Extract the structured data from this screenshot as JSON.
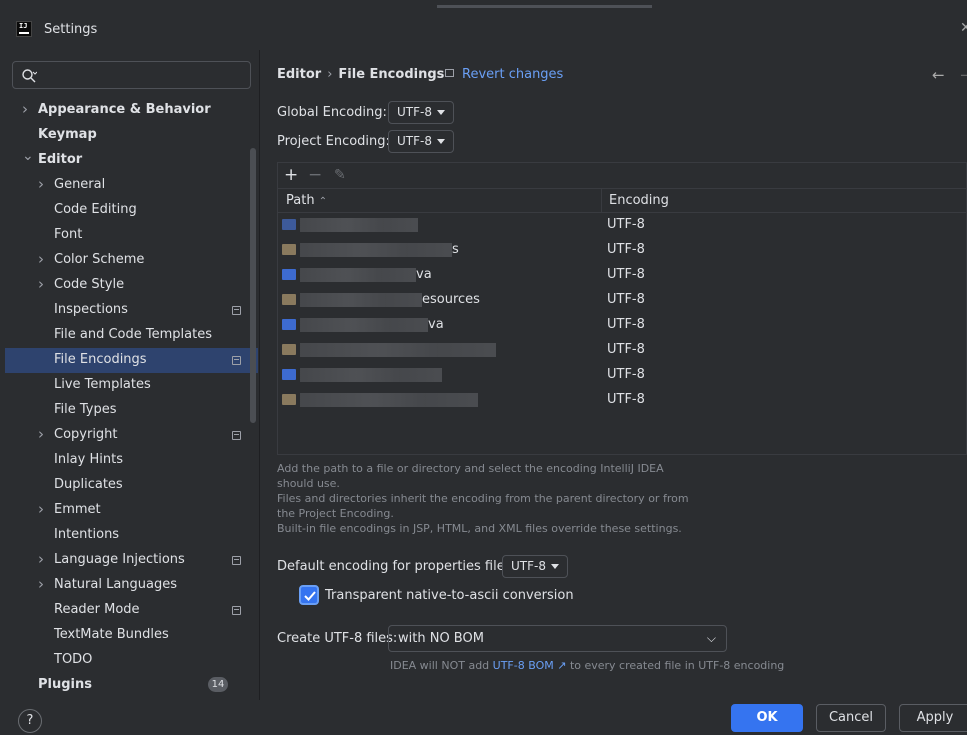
{
  "window": {
    "title": "Settings",
    "logo_text": "IJ"
  },
  "search": {
    "placeholder": "",
    "value": ""
  },
  "sidebar": {
    "items": [
      {
        "label": "Appearance & Behavior",
        "level": 0,
        "bold": true,
        "chevron": "right"
      },
      {
        "label": "Keymap",
        "level": 0,
        "bold": true,
        "chevron": ""
      },
      {
        "label": "Editor",
        "level": 0,
        "bold": true,
        "chevron": "down"
      },
      {
        "label": "General",
        "level": 1,
        "chevron": "right"
      },
      {
        "label": "Code Editing",
        "level": 1,
        "chevron": ""
      },
      {
        "label": "Font",
        "level": 1,
        "chevron": ""
      },
      {
        "label": "Color Scheme",
        "level": 1,
        "chevron": "right"
      },
      {
        "label": "Code Style",
        "level": 1,
        "chevron": "right"
      },
      {
        "label": "Inspections",
        "level": 1,
        "chevron": "",
        "project_icon": true
      },
      {
        "label": "File and Code Templates",
        "level": 1,
        "chevron": ""
      },
      {
        "label": "File Encodings",
        "level": 1,
        "chevron": "",
        "project_icon": true,
        "selected": true
      },
      {
        "label": "Live Templates",
        "level": 1,
        "chevron": ""
      },
      {
        "label": "File Types",
        "level": 1,
        "chevron": ""
      },
      {
        "label": "Copyright",
        "level": 1,
        "chevron": "right",
        "project_icon": true
      },
      {
        "label": "Inlay Hints",
        "level": 1,
        "chevron": ""
      },
      {
        "label": "Duplicates",
        "level": 1,
        "chevron": ""
      },
      {
        "label": "Emmet",
        "level": 1,
        "chevron": "right"
      },
      {
        "label": "Intentions",
        "level": 1,
        "chevron": ""
      },
      {
        "label": "Language Injections",
        "level": 1,
        "chevron": "right",
        "project_icon": true
      },
      {
        "label": "Natural Languages",
        "level": 1,
        "chevron": "right"
      },
      {
        "label": "Reader Mode",
        "level": 1,
        "chevron": "",
        "project_icon": true
      },
      {
        "label": "TextMate Bundles",
        "level": 1,
        "chevron": ""
      },
      {
        "label": "TODO",
        "level": 1,
        "chevron": ""
      },
      {
        "label": "Plugins",
        "level": 0,
        "bold": true,
        "chevron": "",
        "badge": "14"
      }
    ]
  },
  "header": {
    "crumb_parent": "Editor",
    "crumb_current": "File Encodings",
    "revert_label": "Revert changes"
  },
  "encodings": {
    "global_label": "Global Encoding:",
    "global_value": "UTF-8",
    "project_label": "Project Encoding:",
    "project_value": "UTF-8"
  },
  "table": {
    "col_path": "Path",
    "col_encoding": "Encoding",
    "rows": [
      {
        "path_suffix": "",
        "encoding": "UTF-8",
        "icon_color": "#3d5a9a",
        "blur_w": 118
      },
      {
        "path_suffix": "s",
        "encoding": "UTF-8",
        "icon_color": "#8a7a5e",
        "blur_w": 152
      },
      {
        "path_suffix": "va",
        "encoding": "UTF-8",
        "icon_color": "#3d6bd1",
        "blur_w": 116
      },
      {
        "path_suffix": "esources",
        "encoding": "UTF-8",
        "icon_color": "#8a7a5e",
        "blur_w": 122
      },
      {
        "path_suffix": "va",
        "encoding": "UTF-8",
        "icon_color": "#3d6bd1",
        "blur_w": 128
      },
      {
        "path_suffix": "",
        "encoding": "UTF-8",
        "icon_color": "#8a7a5e",
        "blur_w": 196
      },
      {
        "path_suffix": "",
        "encoding": "UTF-8",
        "icon_color": "#3d6bd1",
        "blur_w": 142
      },
      {
        "path_suffix": "",
        "encoding": "UTF-8",
        "icon_color": "#8a7a5e",
        "blur_w": 178
      }
    ]
  },
  "help": {
    "line1": "Add the path to a file or directory and select the encoding IntelliJ IDEA should use.",
    "line2": "Files and directories inherit the encoding from the parent directory or from the Project Encoding.",
    "line3": "Built-in file encodings in JSP, HTML, and XML files override these settings."
  },
  "properties": {
    "label": "Default encoding for properties files:",
    "value": "UTF-8",
    "native_label": "Transparent native-to-ascii conversion",
    "native_checked": true
  },
  "bom": {
    "label": "Create UTF-8 files:",
    "value": "with NO BOM",
    "hint_pre": "IDEA will NOT add",
    "hint_link": "UTF-8 BOM ↗",
    "hint_post": "to every created file in UTF-8 encoding"
  },
  "buttons": {
    "help": "?",
    "ok": "OK",
    "cancel": "Cancel",
    "apply": "Apply"
  },
  "colors": {
    "accent": "#3574f0",
    "selection": "#2e436e",
    "link": "#6a9ff5",
    "background": "#2b2d30"
  }
}
